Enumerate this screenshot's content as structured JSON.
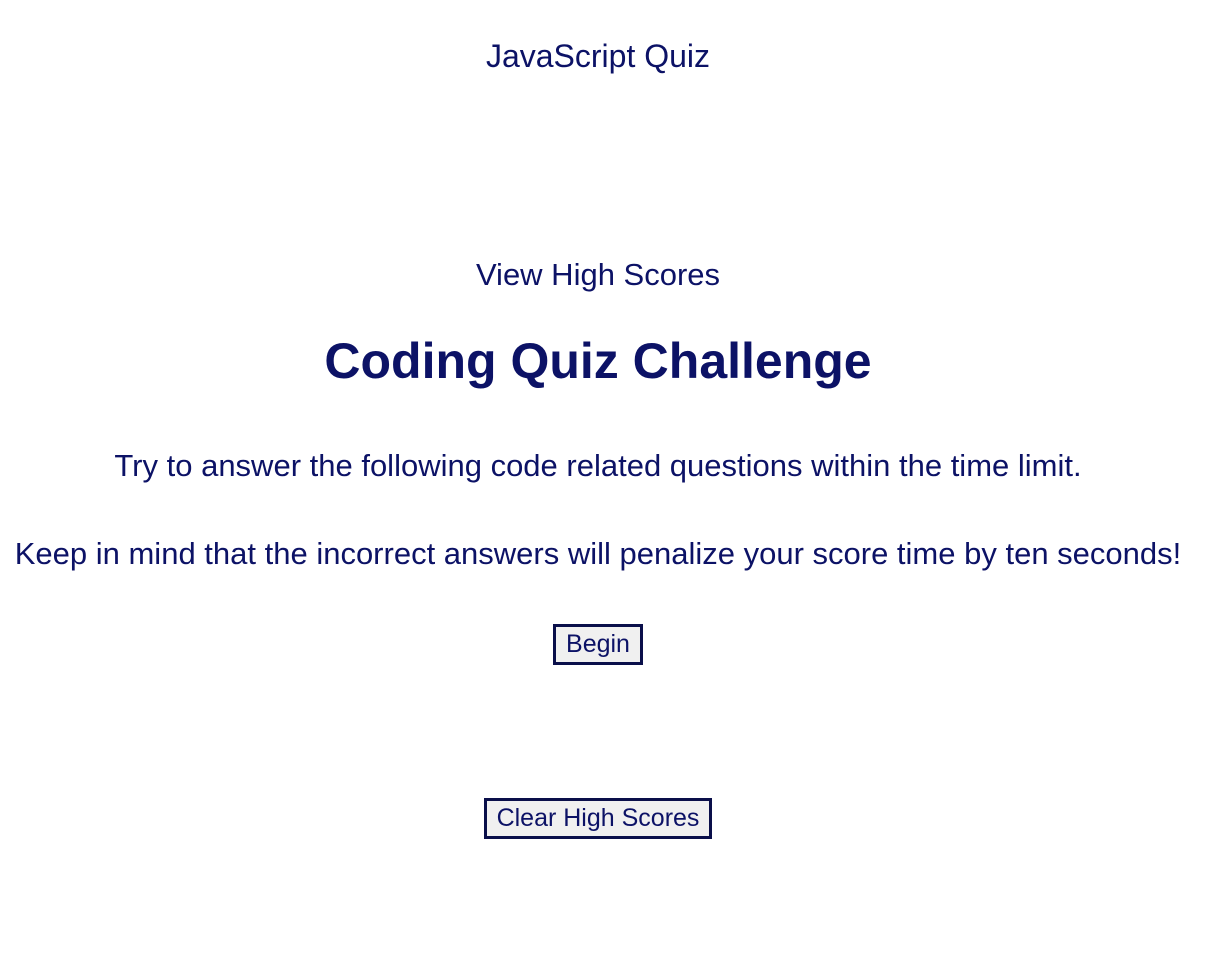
{
  "app_title": "JavaScript Quiz",
  "nav": {
    "view_high_scores": "View High Scores"
  },
  "main": {
    "heading": "Coding Quiz Challenge",
    "intro_line_1": "Try to answer the following code related questions within the time limit.",
    "intro_line_2": "Keep in mind that the incorrect answers will penalize your score time by ten seconds!",
    "begin_label": "Begin"
  },
  "footer": {
    "clear_high_scores_label": "Clear High Scores"
  },
  "colors": {
    "text": "#0c1266",
    "button_border": "#0a0f4a",
    "button_bg": "#f0f0f0",
    "page_bg": "#ffffff"
  }
}
